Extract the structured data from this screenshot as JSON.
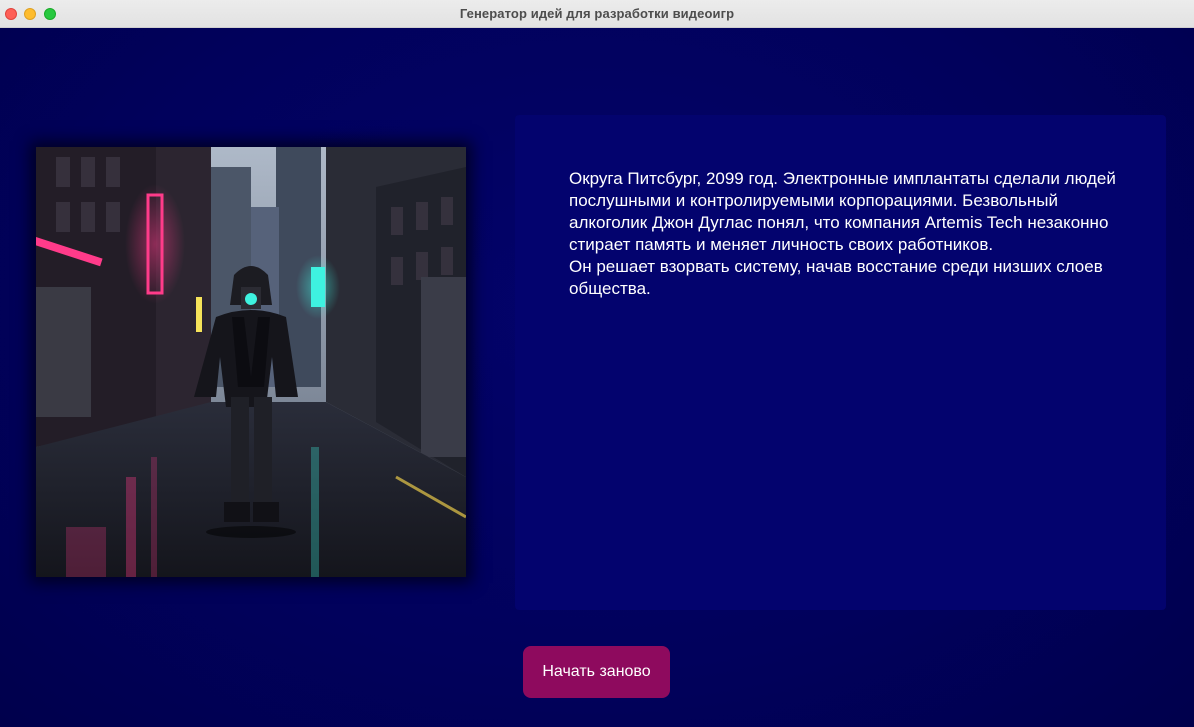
{
  "window": {
    "title": "Генератор идей для разработки видеоигр"
  },
  "story": {
    "paragraph1": "Округа Питсбург, 2099 год. Электронные имплантаты сделали людей послушными и контролируемыми корпорациями. Безвольный алкоголик Джон Дуглас понял, что компания Artemis Tech незаконно стирает память и меняет личность своих работников.",
    "paragraph2": "Он решает взорвать систему, начав восстание среди низших слоев общества."
  },
  "image": {
    "icon": "cyberpunk-character-illustration"
  },
  "actions": {
    "restart_label": "Начать заново"
  },
  "colors": {
    "background": "#010155",
    "panel": "#03036e",
    "button": "#8e0a5e",
    "text": "#ffffff"
  }
}
